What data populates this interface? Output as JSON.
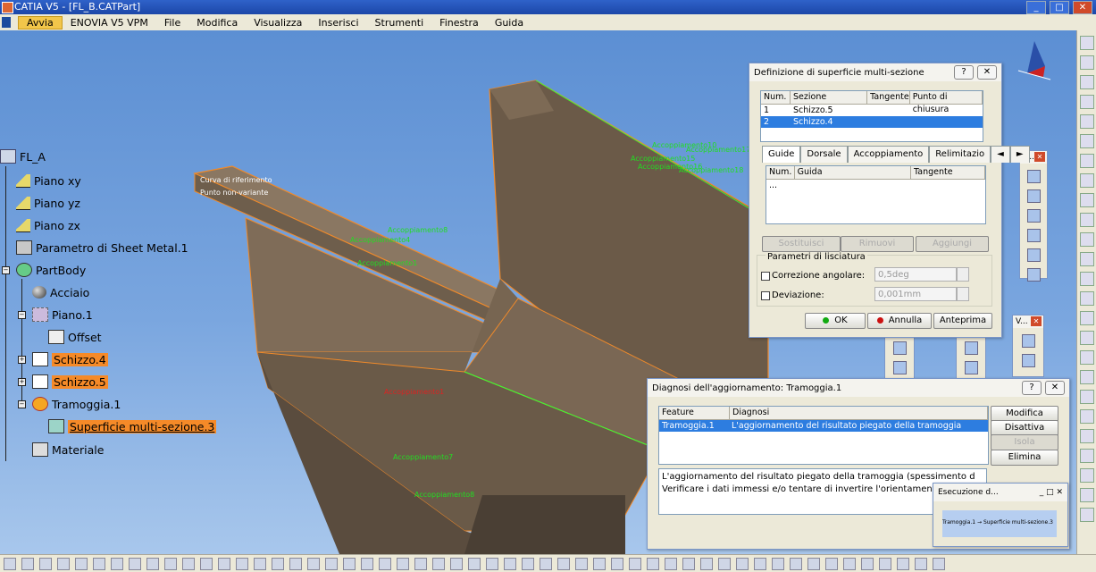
{
  "window": {
    "title": "CATIA V5 - [FL_B.CATPart]"
  },
  "menubar": {
    "items": [
      "Avvia",
      "ENOVIA V5 VPM",
      "File",
      "Modifica",
      "Visualizza",
      "Inserisci",
      "Strumenti",
      "Finestra",
      "Guida"
    ]
  },
  "tree": {
    "root": "FL_A",
    "piano_xy": "Piano xy",
    "piano_yz": "Piano yz",
    "piano_zx": "Piano zx",
    "sheet_metal": "Parametro di Sheet Metal.1",
    "partbody": "PartBody",
    "acciaio": "Acciaio",
    "piano1": "Piano.1",
    "offset": "Offset",
    "schizzo4": "Schizzo.4",
    "schizzo5": "Schizzo.5",
    "tramoggia": "Tramoggia.1",
    "superficie": "Superficie multi-sezione.3",
    "materiale": "Materiale"
  },
  "viewport_labels": {
    "curva": "Curva di riferimento",
    "punto": "Punto non-variante",
    "acc1": "Accoppiamento1",
    "acc1b": "Accoppiamento1",
    "acc4": "Accoppiamento4",
    "acc7": "Accoppiamento7",
    "acc8": "Accoppiamento8",
    "acc10": "Accoppiamento10",
    "acc15": "Accoppiamento15",
    "acc16": "Accoppiamento16",
    "acc17": "Accoppiamento17",
    "acc18": "Accoppiamento18"
  },
  "multisection_dialog": {
    "title": "Definizione di superficie multi-sezione",
    "columns": [
      "Num.",
      "Sezione",
      "Tangente",
      "Punto di chiusura"
    ],
    "rows": [
      {
        "num": "1",
        "sezione": "Schizzo.5"
      },
      {
        "num": "2",
        "sezione": "Schizzo.4"
      }
    ],
    "tabs": [
      "Guide",
      "Dorsale",
      "Accoppiamento",
      "Relimitazio"
    ],
    "guide_columns": [
      "Num.",
      "Guida",
      "Tangente"
    ],
    "guide_row": "...",
    "sostituisci": "Sostituisci",
    "rimuovi": "Rimuovi",
    "aggiungi": "Aggiungi",
    "smoothing_group": "Parametri di lisciatura",
    "correzione_label": "Correzione angolare:",
    "correzione_value": "0,5deg",
    "deviazione_label": "Deviazione:",
    "deviazione_value": "0,001mm",
    "ok": "OK",
    "annulla": "Annulla",
    "anteprima": "Anteprima"
  },
  "update_dialog": {
    "title": "Diagnosi dell'aggiornamento: Tramoggia.1",
    "col_feature": "Feature",
    "col_diagnosi": "Diagnosi",
    "row_feature": "Tramoggia.1",
    "row_diagnosi": "L'aggiornamento del risultato piegato della tramoggia (ispes...",
    "modifica": "Modifica",
    "disattiva": "Disattiva",
    "isola": "Isola",
    "elimina": "Elimina",
    "msg_line1": "L'aggiornamento del risultato piegato della tramoggia (spessimento d",
    "msg_line2": "Verificare i dati immessi e/o tentare di invertire l'orientamento del mate"
  },
  "exec_dialog": {
    "title": "Esecuzione d...",
    "progress_text": "Tramoggia.1 → Superficie multi-sezione.3"
  },
  "mini_toolbars": {
    "t_title": "T...",
    "v_title": "V..."
  },
  "colors": {
    "viewport_top": "#5c8fd3",
    "highlight": "#f58a28",
    "label_green": "#22dd22",
    "selection": "#2d7de0"
  }
}
